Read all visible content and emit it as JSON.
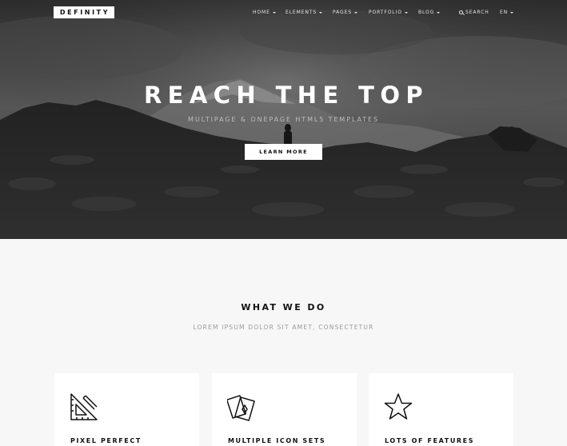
{
  "brand": {
    "logo_text": "DEFINITY"
  },
  "nav": {
    "items": [
      {
        "label": "HOME",
        "has_dropdown": true
      },
      {
        "label": "ELEMENTS",
        "has_dropdown": true
      },
      {
        "label": "PAGES",
        "has_dropdown": true
      },
      {
        "label": "PORTFOLIO",
        "has_dropdown": true
      },
      {
        "label": "BLOG",
        "has_dropdown": true
      }
    ],
    "search_label": "SEARCH",
    "search_icon": "search-icon",
    "language": "EN"
  },
  "hero": {
    "title": "REACH THE TOP",
    "subtitle": "MULTIPAGE & ONEPAGE HTML5 TEMPLATES",
    "button_label": "LEARN MORE"
  },
  "features": {
    "title": "WHAT WE DO",
    "subtitle": "LOREM IPSUM DOLOR SIT AMET, CONSECTETUR",
    "cards": [
      {
        "title": "PIXEL PERFECT",
        "icon": "ruler-triangle-icon"
      },
      {
        "title": "MULTIPLE ICON SETS",
        "icon": "cards-icon"
      },
      {
        "title": "LOTS OF FEATURES",
        "icon": "star-icon"
      }
    ]
  },
  "colors": {
    "text_dark": "#111111",
    "background": "#f7f7f7",
    "card": "#ffffff",
    "hero_overlay": "#3a3a3a"
  }
}
